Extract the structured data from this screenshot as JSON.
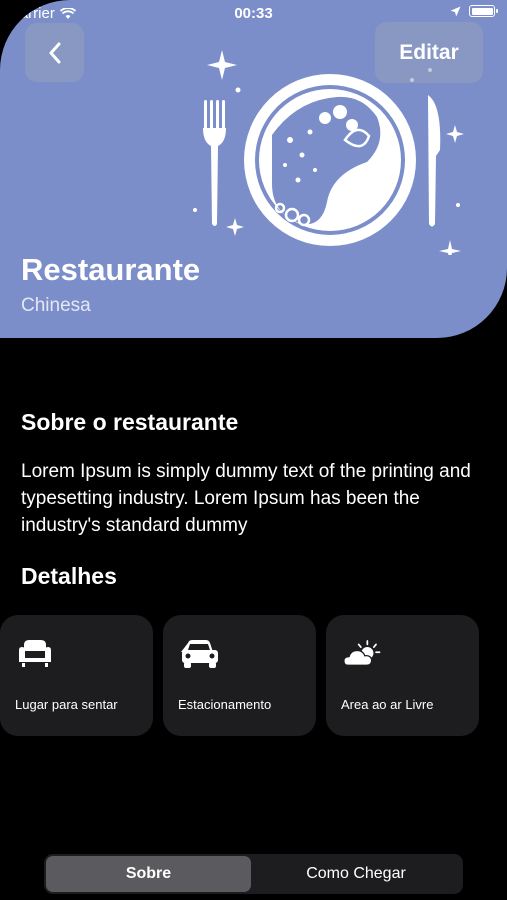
{
  "status_bar": {
    "carrier": "Carrier",
    "time": "00:33"
  },
  "nav": {
    "edit_label": "Editar"
  },
  "restaurant": {
    "name": "Restaurante",
    "cuisine": "Chinesa"
  },
  "about": {
    "title": "Sobre o restaurante",
    "text": "Lorem Ipsum is simply dummy text of the printing and typesetting industry. Lorem Ipsum has been the industry's standard dummy"
  },
  "details": {
    "title": "Detalhes",
    "items": [
      {
        "label": "Lugar para sentar",
        "icon": "sofa-icon"
      },
      {
        "label": "Estacionamento",
        "icon": "car-icon"
      },
      {
        "label": "Area ao ar Livre",
        "icon": "sun-cloud-icon"
      }
    ]
  },
  "tabs": {
    "items": [
      "Sobre",
      "Como Chegar"
    ],
    "selected": "Sobre"
  },
  "colors": {
    "header_bg": "#7b8ec9",
    "card_bg": "#1d1d1f",
    "page_bg": "#000000"
  }
}
